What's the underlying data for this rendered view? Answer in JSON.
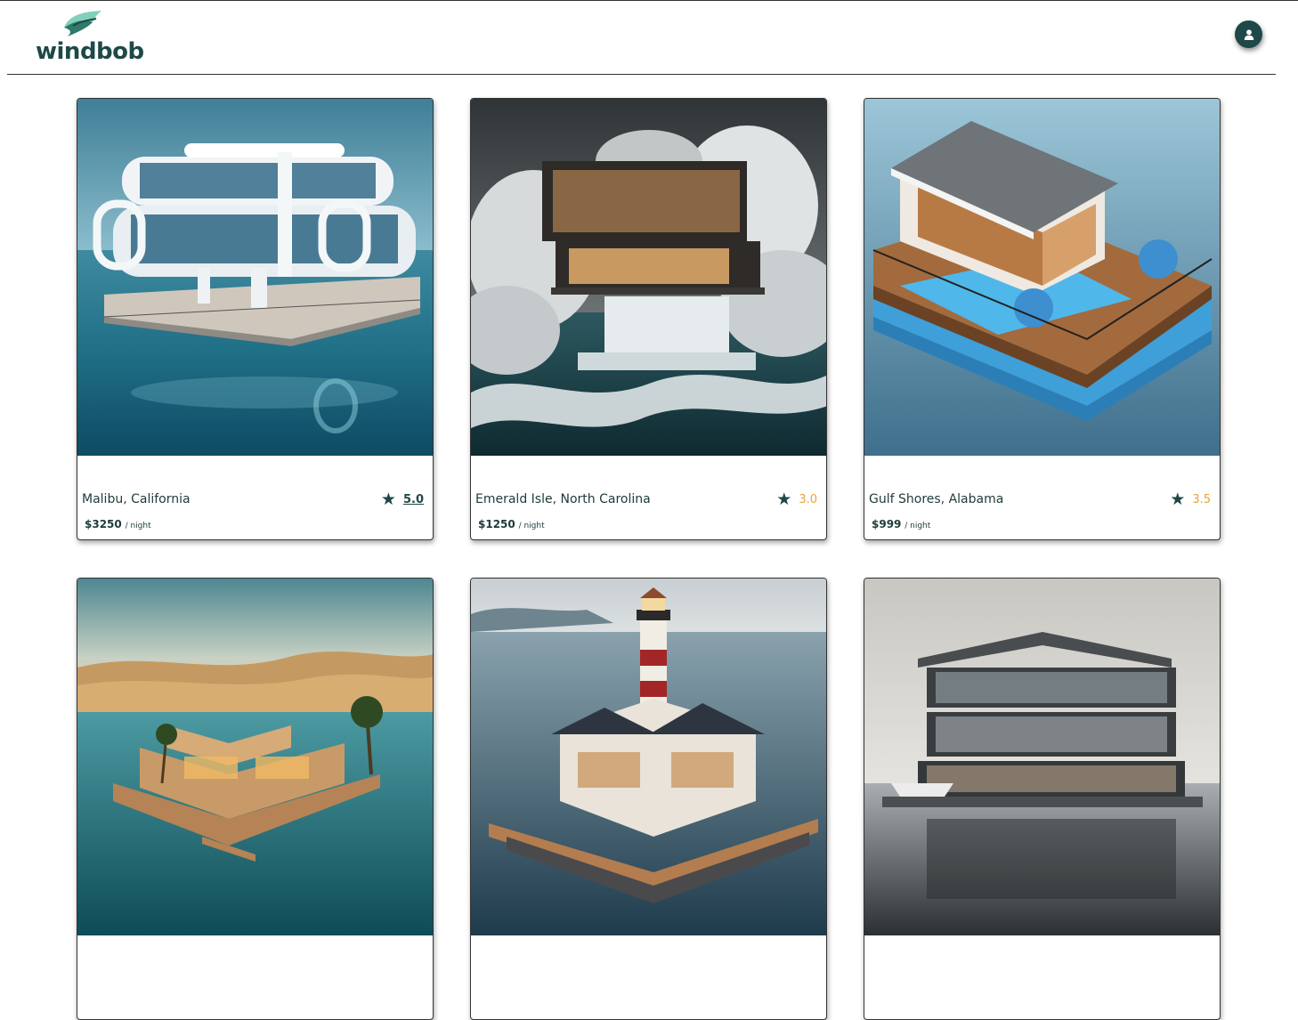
{
  "brand": {
    "name": "windbob"
  },
  "header": {
    "profile_icon": "user-icon"
  },
  "listings": [
    {
      "location": "Malibu, California",
      "rating": "5.0",
      "price": "$3250",
      "per": "/ night",
      "rating_color": "#1f4848"
    },
    {
      "location": "Emerald Isle, North Carolina",
      "rating": "3.0",
      "price": "$1250",
      "per": "/ night",
      "rating_color": "#e8a33a"
    },
    {
      "location": "Gulf Shores, Alabama",
      "rating": "3.5",
      "price": "$999",
      "per": "/ night",
      "rating_color": "#e8a33a"
    },
    {
      "location": "",
      "rating": "",
      "price": "",
      "per": ""
    },
    {
      "location": "",
      "rating": "",
      "price": "",
      "per": ""
    },
    {
      "location": "",
      "rating": "",
      "price": "",
      "per": ""
    }
  ],
  "colors": {
    "brand": "#1f4848",
    "accent": "#e8a33a",
    "logo_wave": "#5fb8a0"
  }
}
